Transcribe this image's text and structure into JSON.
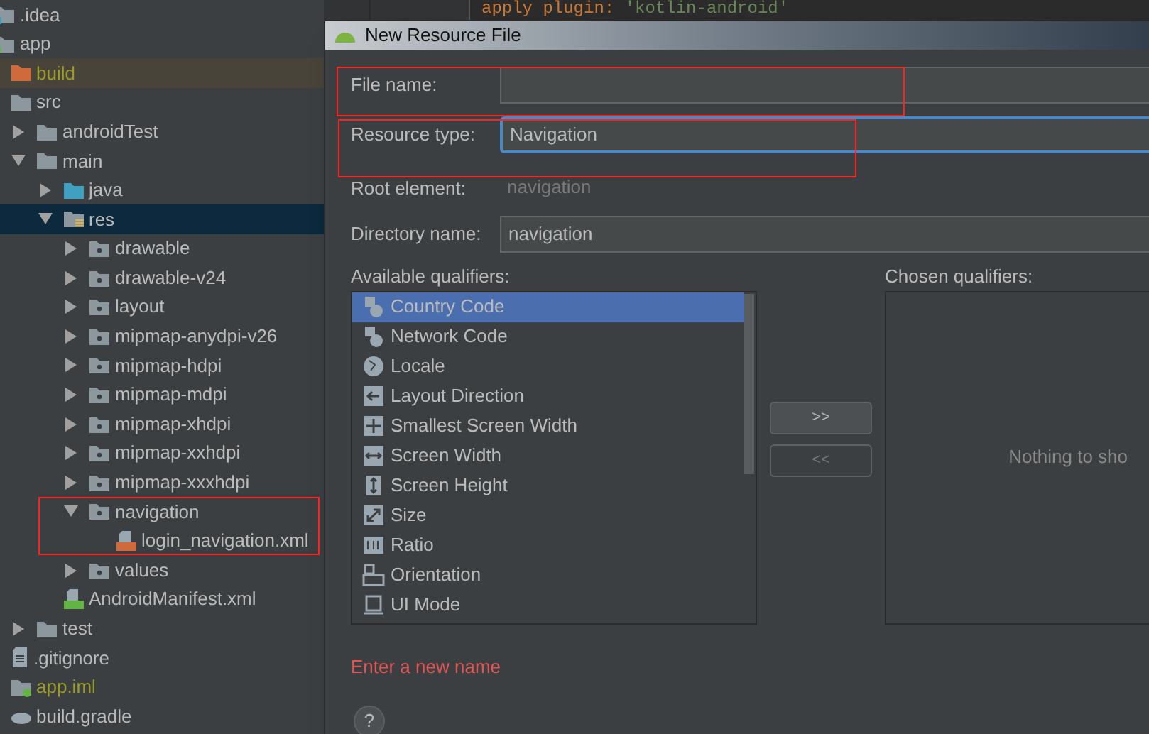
{
  "project_tree": [
    {
      "label": ".idea",
      "kind": "settings-folder"
    },
    {
      "label": "app",
      "kind": "module",
      "children": [
        {
          "label": "build",
          "kind": "build-folder",
          "excluded": true
        },
        {
          "label": "src",
          "kind": "folder",
          "children": [
            {
              "label": "androidTest",
              "kind": "folder",
              "expanded": false
            },
            {
              "label": "main",
              "kind": "folder",
              "expanded": true,
              "children": [
                {
                  "label": "java",
                  "kind": "source-folder",
                  "expanded": false
                },
                {
                  "label": "res",
                  "kind": "res-folder",
                  "expanded": true,
                  "selected": true,
                  "children": [
                    {
                      "label": "drawable",
                      "kind": "res-subfolder",
                      "expanded": false
                    },
                    {
                      "label": "drawable-v24",
                      "kind": "res-subfolder",
                      "expanded": false
                    },
                    {
                      "label": "layout",
                      "kind": "res-subfolder",
                      "expanded": false
                    },
                    {
                      "label": "mipmap-anydpi-v26",
                      "kind": "res-subfolder",
                      "expanded": false
                    },
                    {
                      "label": "mipmap-hdpi",
                      "kind": "res-subfolder",
                      "expanded": false
                    },
                    {
                      "label": "mipmap-mdpi",
                      "kind": "res-subfolder",
                      "expanded": false
                    },
                    {
                      "label": "mipmap-xhdpi",
                      "kind": "res-subfolder",
                      "expanded": false
                    },
                    {
                      "label": "mipmap-xxhdpi",
                      "kind": "res-subfolder",
                      "expanded": false
                    },
                    {
                      "label": "mipmap-xxxhdpi",
                      "kind": "res-subfolder",
                      "expanded": false
                    },
                    {
                      "label": "navigation",
                      "kind": "res-subfolder",
                      "expanded": true,
                      "children": [
                        {
                          "label": "login_navigation.xml",
                          "kind": "xml-file"
                        }
                      ]
                    },
                    {
                      "label": "values",
                      "kind": "res-subfolder",
                      "expanded": false
                    }
                  ]
                },
                {
                  "label": "AndroidManifest.xml",
                  "kind": "manifest-file"
                }
              ]
            },
            {
              "label": "test",
              "kind": "folder",
              "expanded": false
            }
          ]
        },
        {
          "label": ".gitignore",
          "kind": "text-file"
        },
        {
          "label": "app.iml",
          "kind": "iml-file",
          "excluded": true
        },
        {
          "label": "build.gradle",
          "kind": "gradle-file"
        }
      ]
    }
  ],
  "editor": {
    "code_line": {
      "keyword": "apply plugin:",
      "string": "'kotlin-android'"
    }
  },
  "dialog": {
    "title": "New Resource File",
    "file_name": {
      "label": "File name:"
    },
    "resource_type": {
      "label": "Resource type:",
      "value": "Navigation"
    },
    "root_element": {
      "label": "Root element:",
      "value": "navigation"
    },
    "directory_name": {
      "label": "Directory name:",
      "value": "navigation"
    },
    "available_qualifiers": {
      "label": "Available qualifiers:",
      "items": [
        {
          "label": "Country Code",
          "kind": "country",
          "selected": true
        },
        {
          "label": "Network Code",
          "kind": "network",
          "selected": false
        },
        {
          "label": "Locale",
          "kind": "globe",
          "selected": false
        },
        {
          "label": "Layout Direction",
          "kind": "direction",
          "selected": false
        },
        {
          "label": "Smallest Screen Width",
          "kind": "move",
          "selected": false
        },
        {
          "label": "Screen Width",
          "kind": "width",
          "selected": false
        },
        {
          "label": "Screen Height",
          "kind": "height",
          "selected": false
        },
        {
          "label": "Size",
          "kind": "size",
          "selected": false
        },
        {
          "label": "Ratio",
          "kind": "ratio",
          "selected": false
        },
        {
          "label": "Orientation",
          "kind": "orientation",
          "selected": false
        },
        {
          "label": "UI Mode",
          "kind": "uimode",
          "selected": false
        }
      ]
    },
    "add_button": {
      "label": ">>",
      "disabled": false
    },
    "remove_button": {
      "label": "<<",
      "disabled": true
    },
    "chosen_qualifiers": {
      "label": "Chosen qualifiers:",
      "empty_text": "Nothing to sho"
    },
    "error": "Enter a new name",
    "help": "?"
  }
}
